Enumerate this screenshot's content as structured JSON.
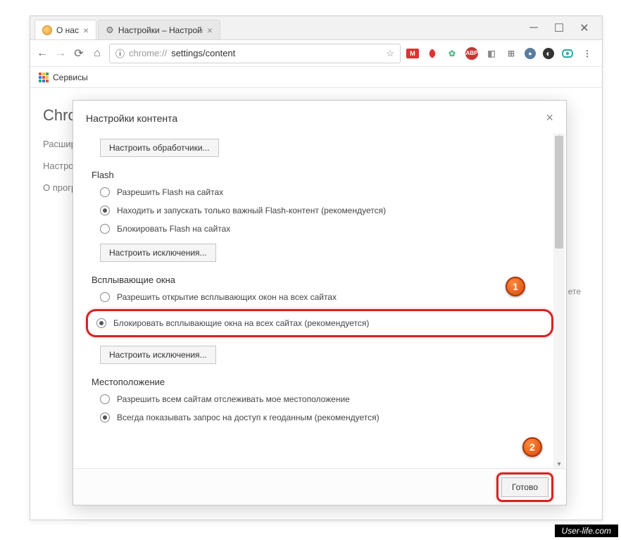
{
  "window": {
    "tabs": [
      {
        "title": "О нас",
        "favicon": "orange"
      },
      {
        "title": "Настройки – Настройки",
        "favicon": "gear"
      }
    ]
  },
  "addressbar": {
    "icon_text": "ⓘ",
    "scheme": "chrome://",
    "path": "settings/content"
  },
  "bookmarks_bar": {
    "apps_label": "Сервисы"
  },
  "background_page": {
    "title": "Chrome",
    "menu_extensions": "Расшире",
    "menu_settings": "Настройк",
    "menu_about": "О програ",
    "right_text": "ете"
  },
  "modal": {
    "title": "Настройки контента",
    "btn_handlers": "Настроить обработчики...",
    "sections": {
      "flash": {
        "title": "Flash",
        "opt_allow": "Разрешить Flash на сайтах",
        "opt_detect": "Находить и запускать только важный Flash-контент (рекомендуется)",
        "opt_block": "Блокировать Flash на сайтах",
        "btn_exceptions": "Настроить исключения..."
      },
      "popups": {
        "title": "Всплывающие окна",
        "opt_allow": "Разрешить открытие всплывающих окон на всех сайтах",
        "opt_block": "Блокировать всплывающие окна на всех сайтах (рекомендуется)",
        "btn_exceptions": "Настроить исключения..."
      },
      "location": {
        "title": "Местоположение",
        "opt_allow": "Разрешить всем сайтам отслеживать мое местоположение",
        "opt_ask": "Всегда показывать запрос на доступ к геоданным (рекомендуется)"
      }
    },
    "footer_done": "Готово"
  },
  "badges": {
    "one": "1",
    "two": "2"
  },
  "watermark": "User-life.com"
}
